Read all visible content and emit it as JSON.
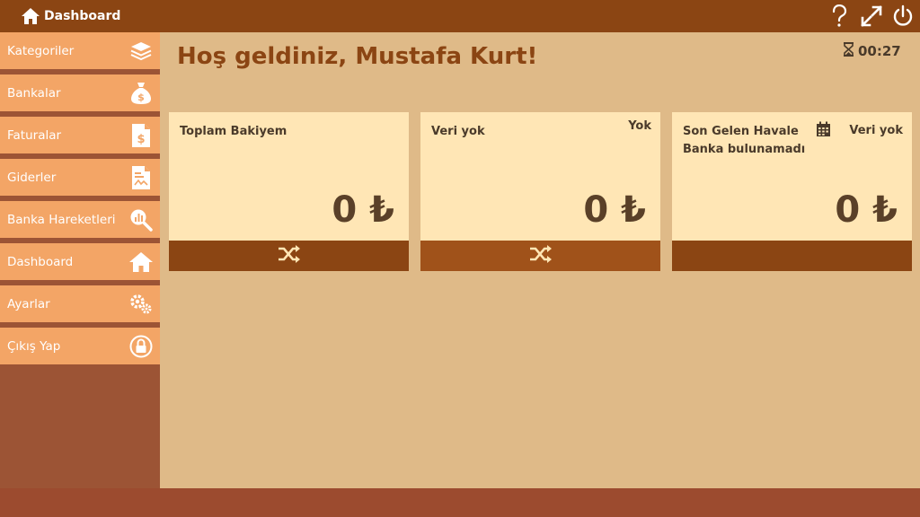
{
  "topbar": {
    "title": "Dashboard",
    "icons": [
      "home-icon",
      "help-icon",
      "fullscreen-icon",
      "power-icon"
    ]
  },
  "sidebar": {
    "items": [
      {
        "label": "Kategoriler",
        "icon": "layers-icon"
      },
      {
        "label": "Bankalar",
        "icon": "money-bag-icon"
      },
      {
        "label": "Faturalar",
        "icon": "invoice-icon"
      },
      {
        "label": "Giderler",
        "icon": "expense-doc-icon"
      },
      {
        "label": "Banka Hareketleri",
        "icon": "chart-search-icon"
      },
      {
        "label": "Dashboard",
        "icon": "home-icon"
      },
      {
        "label": "Ayarlar",
        "icon": "gears-icon"
      },
      {
        "label": "Çıkış Yap",
        "icon": "lock-icon"
      }
    ]
  },
  "main": {
    "welcome": "Hoş geldiniz, Mustafa Kurt!",
    "timer": "00:27"
  },
  "cards": [
    {
      "title": "Toplam Bakiyem",
      "subtitle": "",
      "right": "",
      "amount": "0 ₺",
      "footer_icon": "shuffle-icon"
    },
    {
      "title": "Veri yok",
      "subtitle": "",
      "right": "Yok",
      "amount": "0 ₺",
      "footer_icon": "shuffle-icon"
    },
    {
      "title": "Son Gelen Havale",
      "subtitle": "Banka bulunamadı",
      "right": "Veri yok",
      "amount": "0 ₺",
      "footer_icon": "calendar-icon"
    }
  ],
  "colors": {
    "topbar": "#8b4513",
    "sidebar_item": "#f3a566",
    "sidebar_bg": "#9c5435",
    "main_bg": "#dfba88",
    "card_bg": "#ffe6b5",
    "card_footer_1": "#8b4513",
    "card_footer_2": "#a0521a",
    "card_footer_3": "#8b4513",
    "welcome_text": "#8b4513"
  }
}
